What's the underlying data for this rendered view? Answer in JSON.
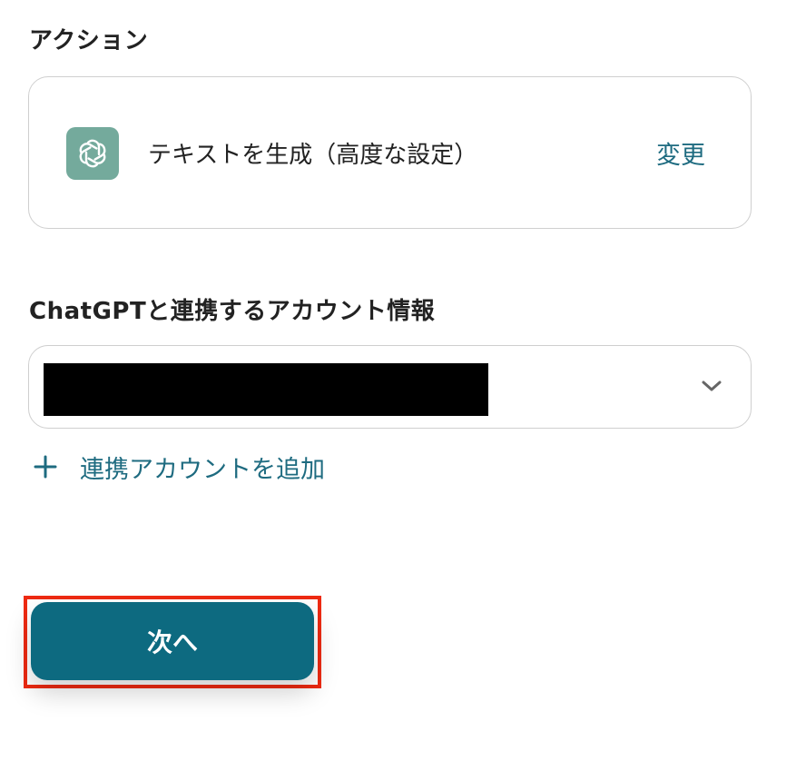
{
  "action": {
    "section_label": "アクション",
    "app_icon": "openai-logo-icon",
    "title": "テキストを生成（高度な設定）",
    "change_label": "変更"
  },
  "account": {
    "section_label": "ChatGPTと連携するアカウント情報",
    "selected_value_redacted": true,
    "add_label": "連携アカウントを追加"
  },
  "footer": {
    "next_label": "次へ"
  },
  "colors": {
    "accent": "#1e6b80",
    "button_bg": "#0d6a80",
    "highlight_border": "#ee2a12",
    "icon_bg": "#74aa9c"
  }
}
